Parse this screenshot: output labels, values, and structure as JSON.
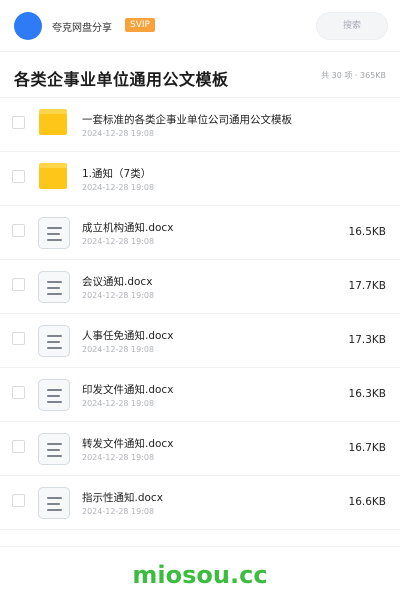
{
  "header": {
    "username": "夸克网盘分享",
    "badge": "SVIP",
    "search_placeholder": "搜索"
  },
  "folder_title": "各类企事业单位通用公文模板",
  "folder_meta": "共 30 项 · 365KB",
  "items": [
    {
      "type": "folder",
      "name": "一套标准的各类企事业单位公司通用公文模板",
      "date": "2024-12-28 19:08",
      "size": ""
    },
    {
      "type": "folder",
      "name": "1.通知（7类）",
      "date": "2024-12-28 19:08",
      "size": ""
    },
    {
      "type": "doc",
      "name": "成立机构通知.docx",
      "date": "2024-12-28 19:08",
      "size": "16.5KB"
    },
    {
      "type": "doc",
      "name": "会议通知.docx",
      "date": "2024-12-28 19:08",
      "size": "17.7KB"
    },
    {
      "type": "doc",
      "name": "人事任免通知.docx",
      "date": "2024-12-28 19:08",
      "size": "17.3KB"
    },
    {
      "type": "doc",
      "name": "印发文件通知.docx",
      "date": "2024-12-28 19:08",
      "size": "16.3KB"
    },
    {
      "type": "doc",
      "name": "转发文件通知.docx",
      "date": "2024-12-28 19:08",
      "size": "16.7KB"
    },
    {
      "type": "doc",
      "name": "指示性通知.docx",
      "date": "2024-12-28 19:08",
      "size": "16.6KB"
    }
  ],
  "watermark": "miosou.cc",
  "colors": {
    "accent": "#2f7bf6",
    "svip": "#f7a23b",
    "folder": "#ffc61a",
    "watermark": "#3cbd3f"
  }
}
